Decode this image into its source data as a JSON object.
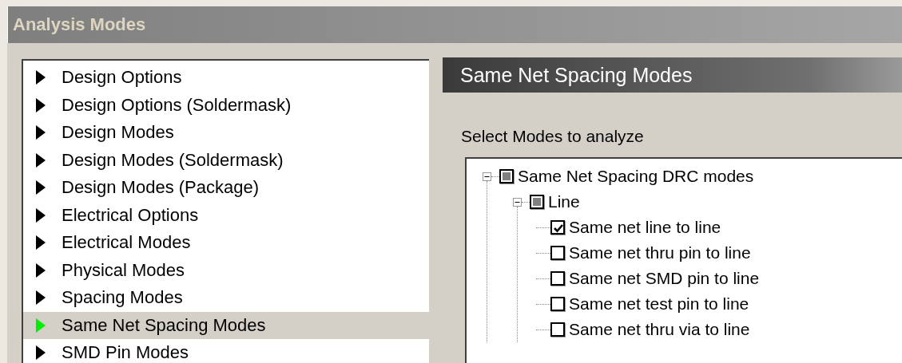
{
  "window": {
    "title": "Analysis Modes"
  },
  "categories": [
    {
      "label": "Design Options",
      "selected": false
    },
    {
      "label": "Design Options (Soldermask)",
      "selected": false
    },
    {
      "label": "Design Modes",
      "selected": false
    },
    {
      "label": "Design Modes (Soldermask)",
      "selected": false
    },
    {
      "label": "Design Modes (Package)",
      "selected": false
    },
    {
      "label": "Electrical Options",
      "selected": false
    },
    {
      "label": "Electrical Modes",
      "selected": false
    },
    {
      "label": "Physical Modes",
      "selected": false
    },
    {
      "label": "Spacing Modes",
      "selected": false
    },
    {
      "label": "Same Net Spacing Modes",
      "selected": true
    },
    {
      "label": "SMD Pin Modes",
      "selected": false
    }
  ],
  "panel": {
    "title": "Same Net Spacing Modes",
    "prompt": "Select Modes to analyze",
    "tree": [
      {
        "label": "Same Net Spacing DRC modes",
        "checked": false,
        "partial": true,
        "expanded": true,
        "children": [
          {
            "label": "Line",
            "checked": false,
            "partial": true,
            "expanded": true,
            "children": [
              {
                "label": "Same net line to line",
                "checked": true
              },
              {
                "label": "Same net thru pin to line",
                "checked": false
              },
              {
                "label": "Same net SMD pin to line",
                "checked": false
              },
              {
                "label": "Same net test pin to line",
                "checked": false
              },
              {
                "label": "Same net thru via to line",
                "checked": false
              }
            ]
          }
        ]
      }
    ]
  }
}
